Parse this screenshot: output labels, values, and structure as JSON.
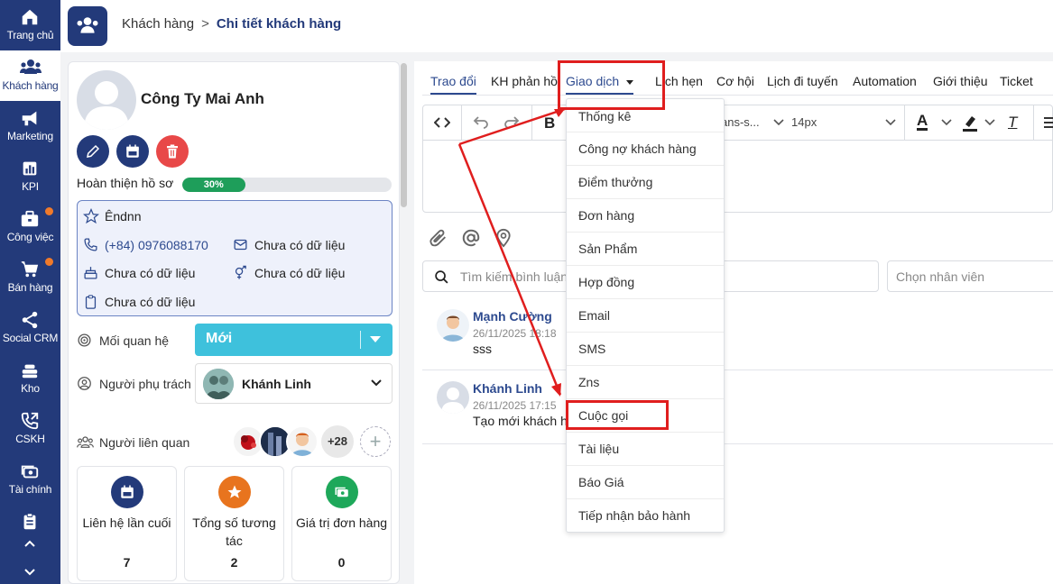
{
  "nav": {
    "items": [
      {
        "label": "Trang chủ",
        "icon": "home-icon"
      },
      {
        "label": "Khách hàng",
        "icon": "users-icon"
      },
      {
        "label": "Marketing",
        "icon": "megaphone-icon"
      },
      {
        "label": "KPI",
        "icon": "chart-icon"
      },
      {
        "label": "Công việc",
        "icon": "briefcase-icon"
      },
      {
        "label": "Bán hàng",
        "icon": "cart-icon"
      },
      {
        "label": "Social CRM",
        "icon": "share-icon"
      },
      {
        "label": "Kho",
        "icon": "stack-icon"
      },
      {
        "label": "CSKH",
        "icon": "phone-icon"
      },
      {
        "label": "Tài chính",
        "icon": "money-icon"
      }
    ]
  },
  "breadcrumb": {
    "parent": "Khách hàng",
    "current": "Chi tiết khách hàng"
  },
  "customer": {
    "name": "Công Ty Mai Anh",
    "profile_label": "Hoàn thiện hồ sơ",
    "progress_label": "30%",
    "progress": 0.3,
    "rating_name": "Êndnn",
    "phone": "(+84) 0976088170",
    "email": "Chưa có dữ liệu",
    "birthday": "Chưa có dữ liệu",
    "gender": "Chưa có dữ liệu",
    "document": "Chưa có dữ liệu"
  },
  "relation": {
    "label": "Mối quan hệ",
    "value": "Mới"
  },
  "owner": {
    "label": "Người phụ trách",
    "name": "Khánh Linh"
  },
  "related": {
    "label": "Người liên quan",
    "more": "+28",
    "add": "+"
  },
  "stats": [
    {
      "label": "Liên hệ lần cuối",
      "value": "7",
      "color": "#233a7a",
      "icon": "calendar-icon"
    },
    {
      "label": "Tổng số tương tác",
      "value": "2",
      "color": "#e8741e",
      "icon": "star-icon"
    },
    {
      "label": "Giá trị đơn hàng",
      "value": "0",
      "color": "#1ea85a",
      "icon": "cash-icon"
    }
  ],
  "tabs": [
    "Trao đổi",
    "KH phản hồi",
    "Giao dịch",
    "Lịch hẹn",
    "Cơ hội",
    "Lịch đi tuyến",
    "Automation",
    "Giới thiệu",
    "Ticket"
  ],
  "editor": {
    "bold": "B",
    "font": "ans-s...",
    "size": "14px",
    "text_color": "A",
    "clear": "T"
  },
  "search": {
    "placeholder": "Tìm kiếm bình luận",
    "staff_placeholder": "Chọn nhân viên"
  },
  "comments": [
    {
      "name": "Mạnh Cường",
      "time": "26/11/2025 18:18",
      "text": "sss"
    },
    {
      "name": "Khánh Linh",
      "time": "26/11/2025 17:15",
      "text": "Tạo mới khách h"
    }
  ],
  "menu": [
    "Thống kê",
    "Công nợ khách hàng",
    "Điểm thưởng",
    "Đơn hàng",
    "Sản Phẩm",
    "Hợp đồng",
    "Email",
    "SMS",
    "Zns",
    "Cuộc gọi",
    "Tài liệu",
    "Báo Giá",
    "Tiếp nhận bảo hành"
  ],
  "colors": {
    "nav": "#233a7a",
    "accent": "#2d4a8f",
    "relation": "#3ec1dc",
    "progress": "#1e9e5a",
    "annotation": "#e01e1e"
  }
}
